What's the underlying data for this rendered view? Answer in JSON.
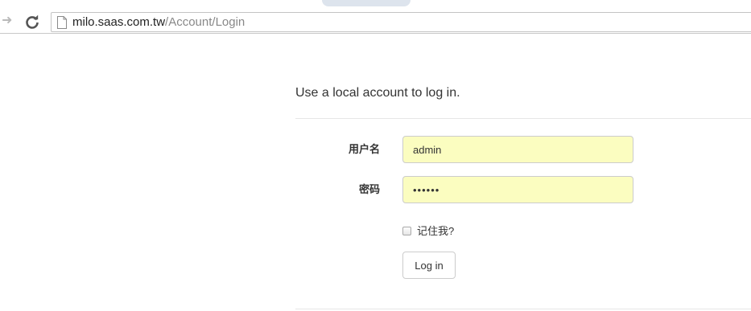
{
  "browser": {
    "forward_icon": "arrow-right-icon",
    "reload_icon": "reload-icon",
    "page_icon": "page-icon",
    "url_host": "milo.saas.com.tw",
    "url_path": "/Account/Login"
  },
  "form": {
    "heading": "Use a local account to log in.",
    "username_label": "用户名",
    "username_value": "admin",
    "password_label": "密码",
    "password_value": "••••••",
    "remember_label": "记住我?",
    "remember_checked": false,
    "login_label": "Log in",
    "field_autofill_color": "#fbfdc0"
  }
}
